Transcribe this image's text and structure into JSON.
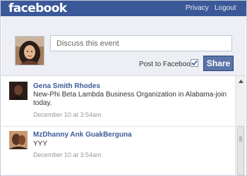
{
  "header": {
    "brand": "facebook",
    "links": [
      "Privacy",
      "Logout"
    ]
  },
  "composer": {
    "placeholder": "Discuss this event",
    "post_to_label": "Post to Facebook",
    "post_to_checked": true,
    "share_label": "Share"
  },
  "feed": {
    "posts": [
      {
        "author": "Gena Smith Rhodes",
        "message": "New-Phi Beta Lambda Business Organization in Alabama-join today.",
        "timestamp": "December 10 at 3:54am"
      },
      {
        "author": "MzDhanny Ank GuakBerguna",
        "message": "YYY",
        "timestamp": "December 10 at 3:54am"
      }
    ]
  },
  "colors": {
    "brand_blue": "#3b5998",
    "composer_bg": "#edeff4",
    "share_button": "#5b74a8"
  },
  "icons": [
    "user-avatar",
    "checkbox-check-icon",
    "scroll-up-arrow-icon",
    "scroll-grip-icon"
  ]
}
